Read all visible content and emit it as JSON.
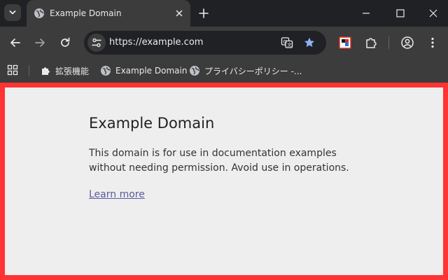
{
  "browser": {
    "tab": {
      "title": "Example Domain"
    },
    "omnibox": {
      "url": "https://example.com"
    },
    "bookmarks": [
      {
        "label": "拡張機能",
        "icon": "puzzle-icon"
      },
      {
        "label": "Example Domain",
        "icon": "globe-icon"
      },
      {
        "label": "プライバシーポリシー -...",
        "icon": "globe-icon"
      }
    ]
  },
  "page": {
    "heading": "Example Domain",
    "body_line1": "This domain is for use in documentation examples",
    "body_line2": "without needing permission. Avoid use in operations.",
    "link": "Learn more"
  },
  "colors": {
    "highlight_border": "#ff3333",
    "bookmark_star": "#8ab4f8",
    "page_background": "#eeeeee",
    "link": "#5a5aa0"
  }
}
